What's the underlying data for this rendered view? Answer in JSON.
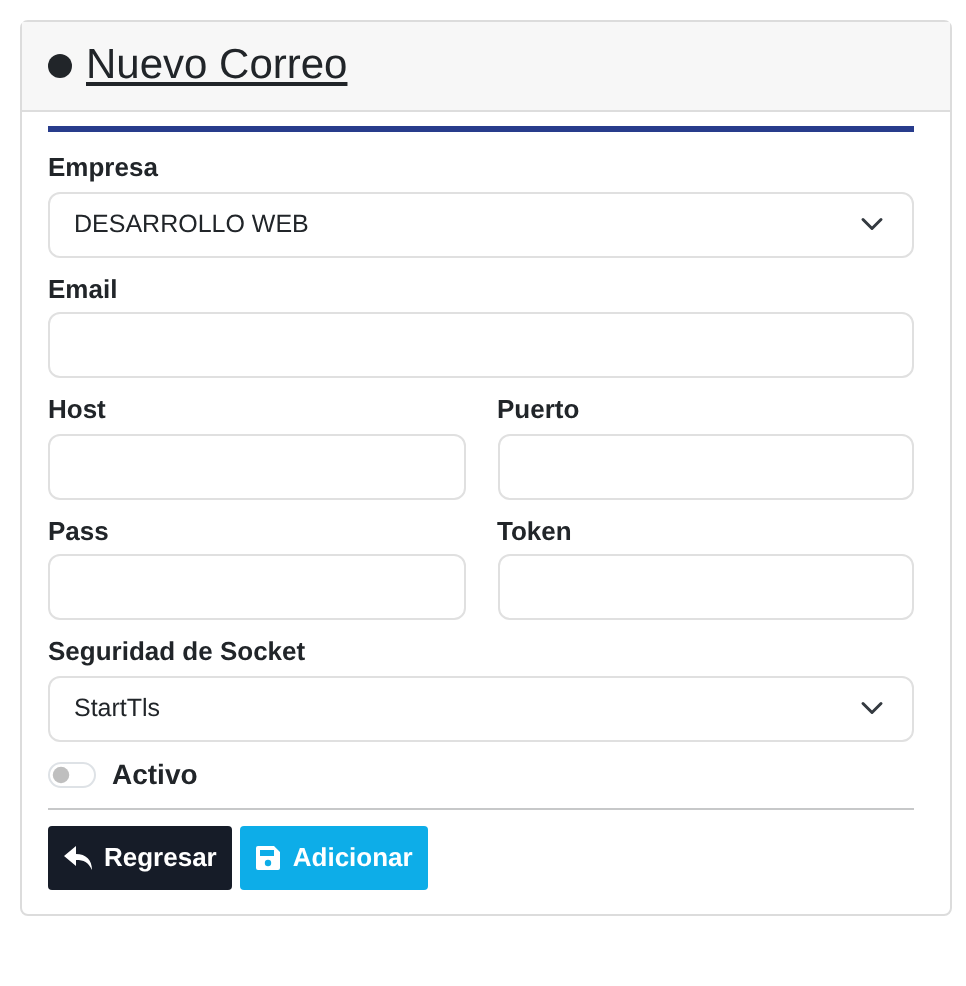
{
  "title": "Nuevo Correo",
  "rows": [
    [
      {
        "label": "Empresa",
        "kind": "select",
        "value": "DESARROLLO WEB"
      }
    ],
    [
      {
        "label": "Email",
        "kind": "text"
      }
    ],
    [
      {
        "label": "Host",
        "kind": "text"
      },
      {
        "label": "Puerto",
        "kind": "text"
      }
    ],
    [
      {
        "label": "Pass",
        "kind": "text"
      },
      {
        "label": "Token",
        "kind": "text"
      }
    ],
    [
      {
        "label": "Seguridad de Socket",
        "kind": "select",
        "value": "StartTls"
      }
    ]
  ],
  "switch": {
    "label": "Activo",
    "on": false
  },
  "buttons": [
    {
      "label": "Regresar",
      "kind": "back"
    },
    {
      "label": "Adicionar",
      "kind": "save"
    }
  ]
}
